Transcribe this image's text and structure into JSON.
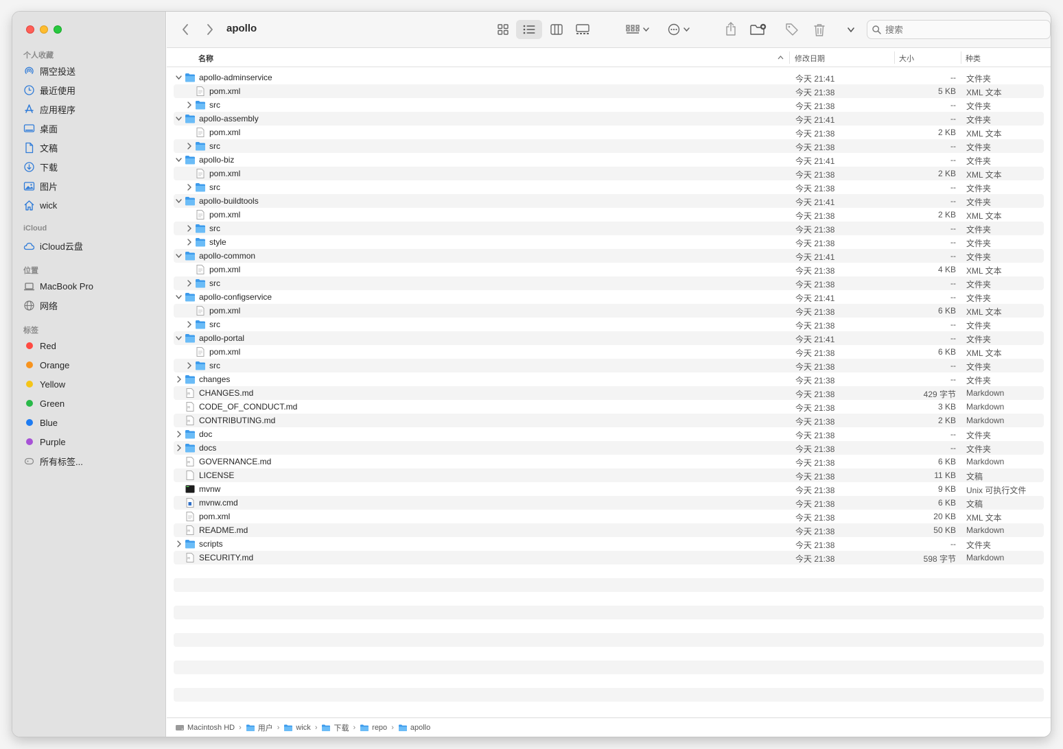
{
  "window": {
    "title": "apollo"
  },
  "colors": {
    "folder": "#4aa5f0",
    "close": "#ff5f57",
    "minimize": "#febc2e",
    "zoom": "#28c840"
  },
  "sidebar": {
    "sections": [
      {
        "label": "个人收藏",
        "items": [
          {
            "icon": "airdrop-icon",
            "label": "隔空投送"
          },
          {
            "icon": "clock-icon",
            "label": "最近使用"
          },
          {
            "icon": "applications-icon",
            "label": "应用程序"
          },
          {
            "icon": "desktop-icon",
            "label": "桌面"
          },
          {
            "icon": "document-icon",
            "label": "文稿"
          },
          {
            "icon": "download-icon",
            "label": "下载"
          },
          {
            "icon": "photos-icon",
            "label": "图片"
          },
          {
            "icon": "home-icon",
            "label": "wick"
          }
        ]
      },
      {
        "label": "iCloud",
        "items": [
          {
            "icon": "cloud-icon",
            "label": "iCloud云盘"
          }
        ]
      },
      {
        "label": "位置",
        "items": [
          {
            "icon": "laptop-icon",
            "label": "MacBook Pro"
          },
          {
            "icon": "network-icon",
            "label": "网络"
          }
        ]
      },
      {
        "label": "标签",
        "items": [
          {
            "icon": "tag-dot",
            "label": "Red",
            "color": "#ff4a42"
          },
          {
            "icon": "tag-dot",
            "label": "Orange",
            "color": "#f7931e"
          },
          {
            "icon": "tag-dot",
            "label": "Yellow",
            "color": "#f5c518"
          },
          {
            "icon": "tag-dot",
            "label": "Green",
            "color": "#29b949"
          },
          {
            "icon": "tag-dot",
            "label": "Blue",
            "color": "#1e7cf2"
          },
          {
            "icon": "tag-dot",
            "label": "Purple",
            "color": "#a752d6"
          },
          {
            "icon": "all-tags-icon",
            "label": "所有标签..."
          }
        ]
      }
    ]
  },
  "search": {
    "placeholder": "搜索"
  },
  "columns": {
    "name": "名称",
    "date": "修改日期",
    "size": "大小",
    "kind": "种类"
  },
  "files": [
    {
      "name": "apollo-adminservice",
      "level": 0,
      "type": "folder",
      "disclosure": "open",
      "date": "今天 21:41",
      "size": "--",
      "kind": "文件夹"
    },
    {
      "name": "pom.xml",
      "level": 1,
      "type": "xml",
      "disclosure": "",
      "date": "今天 21:38",
      "size": "5 KB",
      "kind": "XML 文本"
    },
    {
      "name": "src",
      "level": 1,
      "type": "folder",
      "disclosure": "closed",
      "date": "今天 21:38",
      "size": "--",
      "kind": "文件夹"
    },
    {
      "name": "apollo-assembly",
      "level": 0,
      "type": "folder",
      "disclosure": "open",
      "date": "今天 21:41",
      "size": "--",
      "kind": "文件夹"
    },
    {
      "name": "pom.xml",
      "level": 1,
      "type": "xml",
      "disclosure": "",
      "date": "今天 21:38",
      "size": "2 KB",
      "kind": "XML 文本"
    },
    {
      "name": "src",
      "level": 1,
      "type": "folder",
      "disclosure": "closed",
      "date": "今天 21:38",
      "size": "--",
      "kind": "文件夹"
    },
    {
      "name": "apollo-biz",
      "level": 0,
      "type": "folder",
      "disclosure": "open",
      "date": "今天 21:41",
      "size": "--",
      "kind": "文件夹"
    },
    {
      "name": "pom.xml",
      "level": 1,
      "type": "xml",
      "disclosure": "",
      "date": "今天 21:38",
      "size": "2 KB",
      "kind": "XML 文本"
    },
    {
      "name": "src",
      "level": 1,
      "type": "folder",
      "disclosure": "closed",
      "date": "今天 21:38",
      "size": "--",
      "kind": "文件夹"
    },
    {
      "name": "apollo-buildtools",
      "level": 0,
      "type": "folder",
      "disclosure": "open",
      "date": "今天 21:41",
      "size": "--",
      "kind": "文件夹"
    },
    {
      "name": "pom.xml",
      "level": 1,
      "type": "xml",
      "disclosure": "",
      "date": "今天 21:38",
      "size": "2 KB",
      "kind": "XML 文本"
    },
    {
      "name": "src",
      "level": 1,
      "type": "folder",
      "disclosure": "closed",
      "date": "今天 21:38",
      "size": "--",
      "kind": "文件夹"
    },
    {
      "name": "style",
      "level": 1,
      "type": "folder",
      "disclosure": "closed",
      "date": "今天 21:38",
      "size": "--",
      "kind": "文件夹"
    },
    {
      "name": "apollo-common",
      "level": 0,
      "type": "folder",
      "disclosure": "open",
      "date": "今天 21:41",
      "size": "--",
      "kind": "文件夹"
    },
    {
      "name": "pom.xml",
      "level": 1,
      "type": "xml",
      "disclosure": "",
      "date": "今天 21:38",
      "size": "4 KB",
      "kind": "XML 文本"
    },
    {
      "name": "src",
      "level": 1,
      "type": "folder",
      "disclosure": "closed",
      "date": "今天 21:38",
      "size": "--",
      "kind": "文件夹"
    },
    {
      "name": "apollo-configservice",
      "level": 0,
      "type": "folder",
      "disclosure": "open",
      "date": "今天 21:41",
      "size": "--",
      "kind": "文件夹"
    },
    {
      "name": "pom.xml",
      "level": 1,
      "type": "xml",
      "disclosure": "",
      "date": "今天 21:38",
      "size": "6 KB",
      "kind": "XML 文本"
    },
    {
      "name": "src",
      "level": 1,
      "type": "folder",
      "disclosure": "closed",
      "date": "今天 21:38",
      "size": "--",
      "kind": "文件夹"
    },
    {
      "name": "apollo-portal",
      "level": 0,
      "type": "folder",
      "disclosure": "open",
      "date": "今天 21:41",
      "size": "--",
      "kind": "文件夹"
    },
    {
      "name": "pom.xml",
      "level": 1,
      "type": "xml",
      "disclosure": "",
      "date": "今天 21:38",
      "size": "6 KB",
      "kind": "XML 文本"
    },
    {
      "name": "src",
      "level": 1,
      "type": "folder",
      "disclosure": "closed",
      "date": "今天 21:38",
      "size": "--",
      "kind": "文件夹"
    },
    {
      "name": "changes",
      "level": 0,
      "type": "folder",
      "disclosure": "closed",
      "date": "今天 21:38",
      "size": "--",
      "kind": "文件夹"
    },
    {
      "name": "CHANGES.md",
      "level": 0,
      "type": "md",
      "disclosure": "",
      "date": "今天 21:38",
      "size": "429 字节",
      "kind": "Markdown"
    },
    {
      "name": "CODE_OF_CONDUCT.md",
      "level": 0,
      "type": "md",
      "disclosure": "",
      "date": "今天 21:38",
      "size": "3 KB",
      "kind": "Markdown"
    },
    {
      "name": "CONTRIBUTING.md",
      "level": 0,
      "type": "md",
      "disclosure": "",
      "date": "今天 21:38",
      "size": "2 KB",
      "kind": "Markdown"
    },
    {
      "name": "doc",
      "level": 0,
      "type": "folder",
      "disclosure": "closed",
      "date": "今天 21:38",
      "size": "--",
      "kind": "文件夹"
    },
    {
      "name": "docs",
      "level": 0,
      "type": "folder",
      "disclosure": "closed",
      "date": "今天 21:38",
      "size": "--",
      "kind": "文件夹"
    },
    {
      "name": "GOVERNANCE.md",
      "level": 0,
      "type": "md",
      "disclosure": "",
      "date": "今天 21:38",
      "size": "6 KB",
      "kind": "Markdown"
    },
    {
      "name": "LICENSE",
      "level": 0,
      "type": "doc",
      "disclosure": "",
      "date": "今天 21:38",
      "size": "11 KB",
      "kind": "文稿"
    },
    {
      "name": "mvnw",
      "level": 0,
      "type": "exec",
      "disclosure": "",
      "date": "今天 21:38",
      "size": "9 KB",
      "kind": "Unix 可执行文件"
    },
    {
      "name": "mvnw.cmd",
      "level": 0,
      "type": "cmd",
      "disclosure": "",
      "date": "今天 21:38",
      "size": "6 KB",
      "kind": "文稿"
    },
    {
      "name": "pom.xml",
      "level": 0,
      "type": "xml",
      "disclosure": "",
      "date": "今天 21:38",
      "size": "20 KB",
      "kind": "XML 文本"
    },
    {
      "name": "README.md",
      "level": 0,
      "type": "md",
      "disclosure": "",
      "date": "今天 21:38",
      "size": "50 KB",
      "kind": "Markdown"
    },
    {
      "name": "scripts",
      "level": 0,
      "type": "folder",
      "disclosure": "closed",
      "date": "今天 21:38",
      "size": "--",
      "kind": "文件夹"
    },
    {
      "name": "SECURITY.md",
      "level": 0,
      "type": "md",
      "disclosure": "",
      "date": "今天 21:38",
      "size": "598 字节",
      "kind": "Markdown"
    }
  ],
  "pathbar": [
    {
      "icon": "disk-icon",
      "label": "Macintosh HD"
    },
    {
      "icon": "folder-icon",
      "label": "用户"
    },
    {
      "icon": "folder-icon",
      "label": "wick"
    },
    {
      "icon": "folder-icon",
      "label": "下载"
    },
    {
      "icon": "folder-icon",
      "label": "repo"
    },
    {
      "icon": "folder-icon",
      "label": "apollo"
    }
  ]
}
